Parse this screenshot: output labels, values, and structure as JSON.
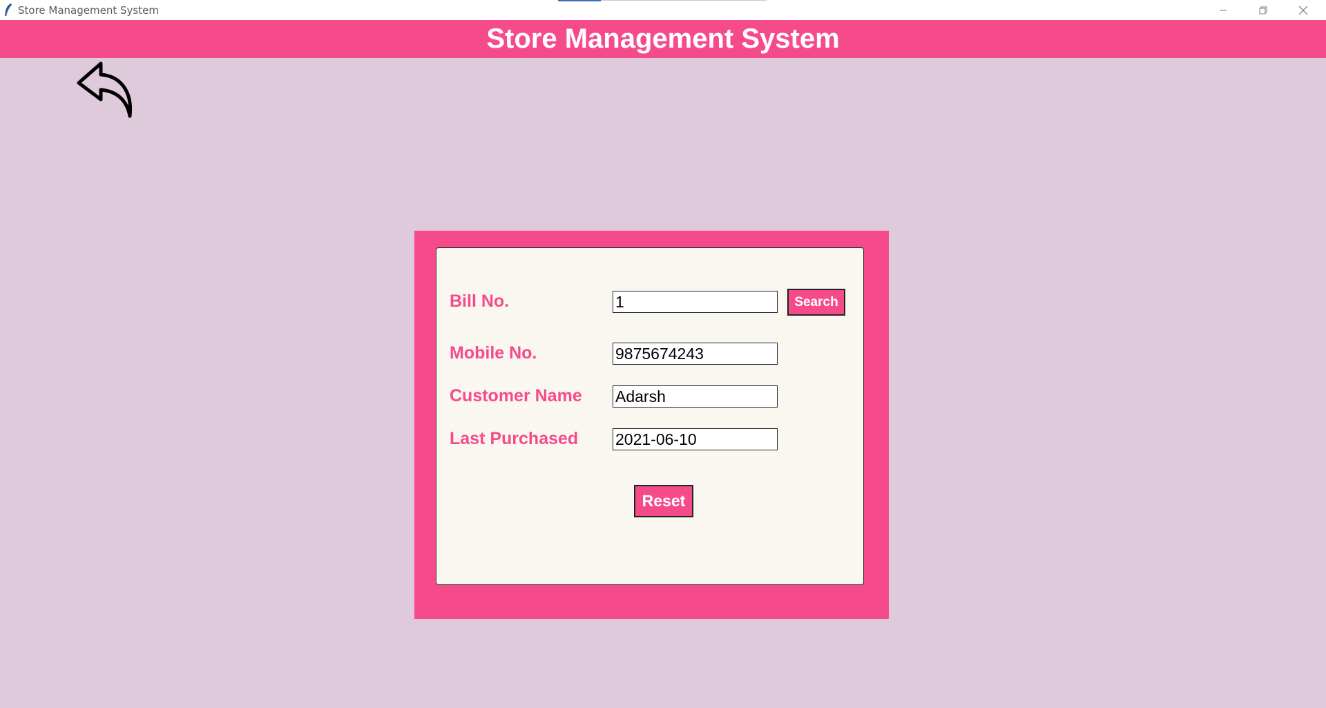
{
  "window": {
    "title": "Store Management System",
    "controls": [
      "minimize-icon",
      "restore-icon",
      "close-icon"
    ]
  },
  "header": {
    "title": "Store Management System"
  },
  "back_button": {
    "icon": "back-arrow-icon"
  },
  "form": {
    "bill_no": {
      "label": "Bill No.",
      "value": "1"
    },
    "search_label": "Search",
    "mobile_no": {
      "label": "Mobile No.",
      "value": "9875674243"
    },
    "customer_name": {
      "label": "Customer Name",
      "value": "Adarsh"
    },
    "last_purchased": {
      "label": "Last Purchased",
      "value": "2021-06-10"
    },
    "reset_label": "Reset"
  },
  "colors": {
    "accent": "#f64b8b",
    "background": "#dfcadc",
    "card": "#faf6f0"
  }
}
